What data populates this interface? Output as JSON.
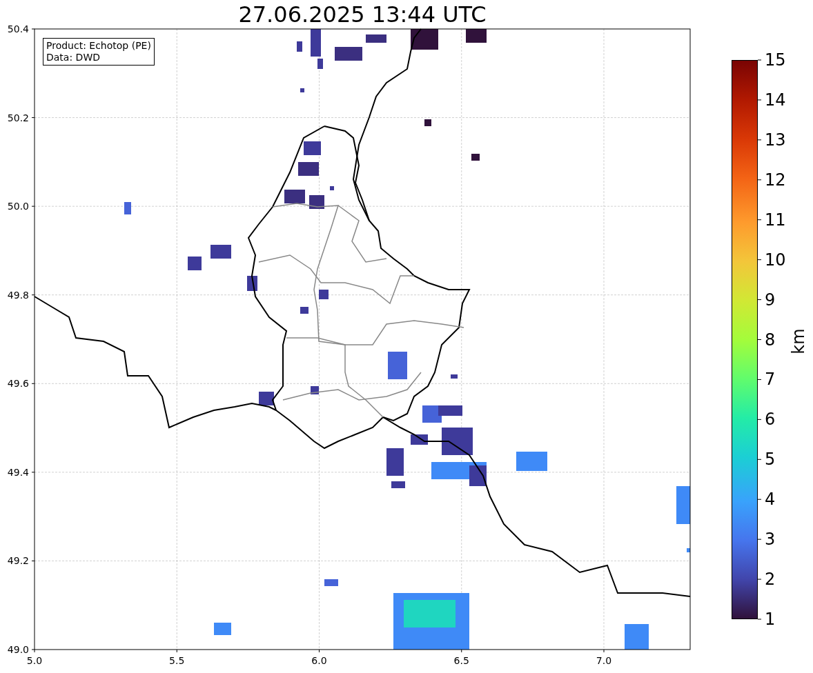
{
  "title": "27.06.2025 13:44 UTC",
  "info_box": [
    "Product: Echotop (PE)",
    "Data: DWD"
  ],
  "x_ticks": [
    "5.0",
    "5.5",
    "6.0",
    "6.5",
    "7.0"
  ],
  "y_ticks": [
    "50.4",
    "50.2",
    "50.0",
    "49.8",
    "49.6",
    "49.4",
    "49.2",
    "49.0"
  ],
  "colorbar": {
    "label": "km",
    "ticks": [
      "15",
      "14",
      "13",
      "12",
      "11",
      "10",
      "9",
      "8",
      "7",
      "6",
      "5",
      "4",
      "3",
      "2",
      "1"
    ]
  }
}
